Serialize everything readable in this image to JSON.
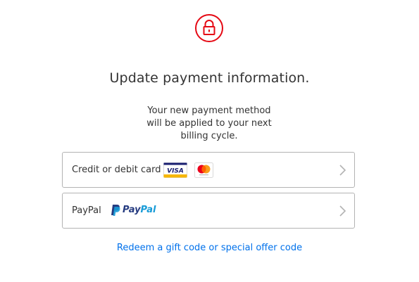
{
  "header": {
    "lock_icon": "padlock-icon",
    "accent_color": "#e50914",
    "title": "Update payment information."
  },
  "subtitle": {
    "lines": [
      "Your new payment method",
      "will be applied to your next",
      "billing cycle."
    ]
  },
  "options": [
    {
      "label": "Credit or debit card",
      "logos": [
        "visa-logo",
        "mastercard-logo"
      ],
      "visa_text": "VISA",
      "chevron_icon": "chevron-right-icon"
    },
    {
      "label": "PayPal",
      "logos": [
        "paypal-logo"
      ],
      "paypal_text_pay": "Pay",
      "paypal_text_pal": "Pal",
      "chevron_icon": "chevron-right-icon"
    }
  ],
  "footer": {
    "redeem_link": "Redeem a gift code or special offer code",
    "link_color": "#0071eb"
  }
}
